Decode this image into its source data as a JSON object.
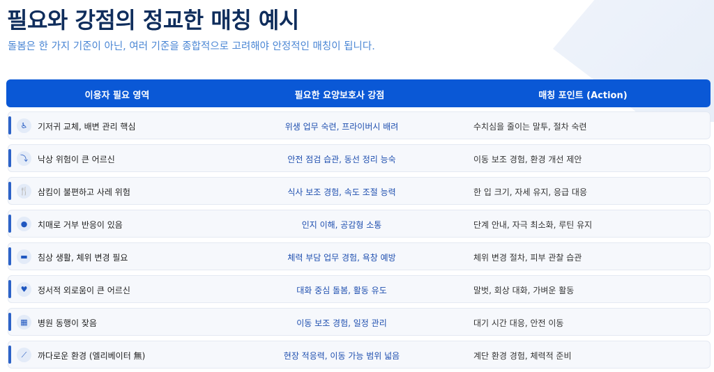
{
  "page": {
    "title": "필요와 강점의 정교한 매칭 예시",
    "subtitle": "돌봄은 한 가지 기준이 아닌, 여러 기준을 종합적으로 고려해야 안정적인 매칭이 됩니다."
  },
  "table": {
    "headers": [
      "이용자 필요 영역",
      "필요한 요양보호사 강점",
      "매칭 포인트 (Action)"
    ],
    "rows": [
      {
        "icon": "baby-diaper-icon",
        "glyph": "♿",
        "need": "기저귀 교체, 배변 관리 핵심",
        "strength": "위생 업무 숙련, 프라이버시 배려",
        "action": "수치심을 줄이는 말투, 절차 숙련"
      },
      {
        "icon": "fall-person-icon",
        "glyph": "⤵",
        "need": "낙상 위험이 큰 어르신",
        "strength": "안전 점검 습관, 동선 정리 능숙",
        "action": "이동 보조 경험, 환경 개선 제안"
      },
      {
        "icon": "utensils-icon",
        "glyph": "🍴",
        "need": "삼킴이 불편하고 사레 위험",
        "strength": "식사 보조 경험, 속도 조절 능력",
        "action": "한 입 크기, 자세 유지, 응급 대응"
      },
      {
        "icon": "brain-icon",
        "glyph": "●",
        "need": "치매로 거부 반응이 있음",
        "strength": "인지 이해, 공감형 소통",
        "action": "단계 안내, 자극 최소화, 루틴 유지"
      },
      {
        "icon": "bed-icon",
        "glyph": "▬",
        "need": "침상 생활, 체위 변경 필요",
        "strength": "체력 부담 업무 경험, 욕창 예방",
        "action": "체위 변경 절차, 피부 관찰 습관"
      },
      {
        "icon": "heart-icon",
        "glyph": "♥",
        "need": "정서적 외로움이 큰 어르신",
        "strength": "대화 중심 돌봄, 활동 유도",
        "action": "말벗, 회상 대화, 가벼운 활동"
      },
      {
        "icon": "hospital-icon",
        "glyph": "▦",
        "need": "병원 동행이 잦음",
        "strength": "이동 보조 경험, 일정 관리",
        "action": "대기 시간 대응, 안전 이동"
      },
      {
        "icon": "stairs-icon",
        "glyph": "⟋",
        "need": "까다로운 환경 (엘리베이터 無)",
        "strength": "현장 적응력, 이동 가능 범위 넓음",
        "action": "계단 환경 경험, 체력적 준비"
      }
    ]
  }
}
